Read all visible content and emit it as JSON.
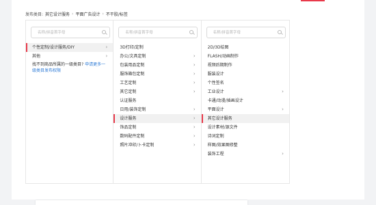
{
  "breadcrumb": {
    "prefix": "发布类目:",
    "items": [
      "其它设计服务",
      "平面广告设计",
      "不干胶/标签"
    ],
    "separator": "›"
  },
  "columns": [
    {
      "search_placeholder": "名称/拼音首字母",
      "items": [
        {
          "label": "个性定制/设计服务/DIY",
          "has_children": true,
          "selected": true
        },
        {
          "label": "其他",
          "has_children": true,
          "selected": false
        }
      ],
      "note": {
        "text": "找不到商品所属的一级类目?",
        "link": "申请更多一级类目发布权限"
      }
    },
    {
      "search_placeholder": "名称/拼音首字母",
      "items": [
        {
          "label": "3D打印/定制",
          "has_children": false,
          "selected": false
        },
        {
          "label": "办公/文具定制",
          "has_children": true,
          "selected": false
        },
        {
          "label": "包装用品定制",
          "has_children": true,
          "selected": false
        },
        {
          "label": "服饰箱包定制",
          "has_children": true,
          "selected": false
        },
        {
          "label": "工艺定制",
          "has_children": true,
          "selected": false
        },
        {
          "label": "其它定制",
          "has_children": true,
          "selected": false
        },
        {
          "label": "认证服务",
          "has_children": false,
          "selected": false
        },
        {
          "label": "日用/装饰定制",
          "has_children": true,
          "selected": false
        },
        {
          "label": "设计服务",
          "has_children": true,
          "selected": true
        },
        {
          "label": "饰品定制",
          "has_children": true,
          "selected": false
        },
        {
          "label": "数码配件定制",
          "has_children": true,
          "selected": false
        },
        {
          "label": "照片冲印/卜卡定制",
          "has_children": true,
          "selected": false
        }
      ]
    },
    {
      "search_placeholder": "名称/拼音首字母",
      "items": [
        {
          "label": "2D/3D绘图",
          "has_children": false,
          "selected": false
        },
        {
          "label": "FLASH/动画制作",
          "has_children": false,
          "selected": false
        },
        {
          "label": "视频后期制作",
          "has_children": false,
          "selected": false
        },
        {
          "label": "服装设计",
          "has_children": false,
          "selected": false
        },
        {
          "label": "个性签名",
          "has_children": false,
          "selected": false
        },
        {
          "label": "工业设计",
          "has_children": true,
          "selected": false
        },
        {
          "label": "卡通/动漫/插画设计",
          "has_children": false,
          "selected": false
        },
        {
          "label": "平面设计",
          "has_children": true,
          "selected": false
        },
        {
          "label": "其它设计服务",
          "has_children": false,
          "selected": true
        },
        {
          "label": "设计素材/源文件",
          "has_children": false,
          "selected": false
        },
        {
          "label": "诗词定制",
          "has_children": false,
          "selected": false
        },
        {
          "label": "样图/效果图修整",
          "has_children": false,
          "selected": false
        },
        {
          "label": "装饰工程",
          "has_children": true,
          "selected": false
        }
      ]
    }
  ],
  "chevron_glyph": "›",
  "colors": {
    "accent": "#e8394a",
    "link": "#2e7bd6",
    "selected_bg": "#f1f1f1",
    "border": "#e6e6e6"
  }
}
